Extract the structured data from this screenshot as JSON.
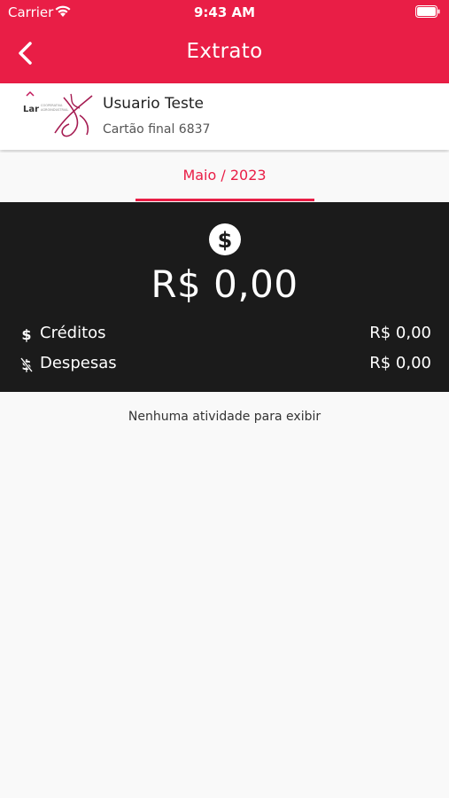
{
  "status_bar": {
    "carrier": "Carrier",
    "time": "9:43 AM"
  },
  "header": {
    "title": "Extrato",
    "color": "#e91e46"
  },
  "card": {
    "logo_text": "Lar",
    "logo_subtext_1": "COOPERATIVA",
    "logo_subtext_2": "AGROINDUSTRIAL",
    "user_name": "Usuario Teste",
    "card_number_text": "Cartão final 6837"
  },
  "month_tab": {
    "label": "Maio / 2023"
  },
  "summary": {
    "total": "R$  0,00",
    "credits_label": "Créditos",
    "credits_value": "R$  0,00",
    "expenses_label": "Despesas",
    "expenses_value": "R$  0,00"
  },
  "empty_state": {
    "message": "Nenhuma atividade para exibir"
  }
}
